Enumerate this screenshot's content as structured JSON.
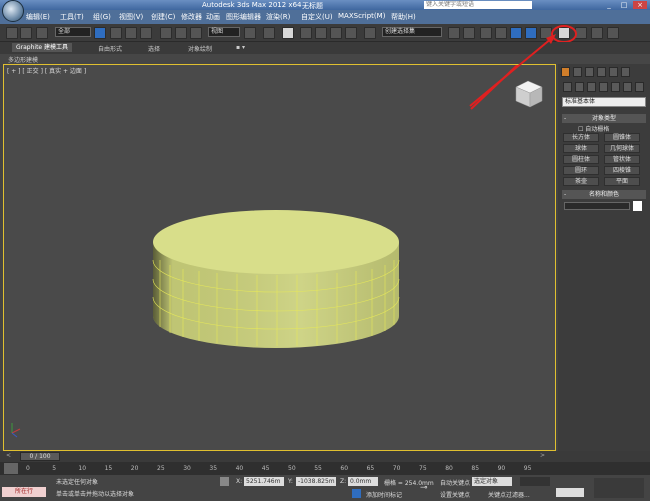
{
  "titlebar": {
    "app_title": "Autodesk 3ds Max  2012 x64",
    "doc_title": "无标题",
    "search_placeholder": "键入关键字或短语",
    "minimize": "_",
    "maximize": "□",
    "close": "×"
  },
  "menu": {
    "items": [
      "编辑(E)",
      "工具(T)",
      "组(G)",
      "视图(V)",
      "创建(C)",
      "修改器",
      "动画",
      "图形编辑器",
      "渲染(R)",
      "自定义(U)",
      "MAXScript(M)",
      "帮助(H)"
    ]
  },
  "toolbar": {
    "selection_filter": "全部",
    "ref_coord": "视图",
    "named_selection": "创建选择集"
  },
  "ribbon": {
    "tabs": [
      "Graphite 建模工具",
      "自由形式",
      "选择",
      "对象绘制"
    ],
    "sub_label": "多边形建模"
  },
  "viewport": {
    "label": "[ + ] [ 正交 ] [ 真实 + 边面 ]"
  },
  "cmdpanel": {
    "dropdown": "标准基本体",
    "object_type_header": "对象类型",
    "autogrid": "自动栅格",
    "buttons": [
      "长方体",
      "圆锥体",
      "球体",
      "几何球体",
      "圆柱体",
      "管状体",
      "圆环",
      "四棱锥",
      "茶壶",
      "平面"
    ],
    "name_color_header": "名称和颜色"
  },
  "timeline": {
    "frame_readout": "0 / 100",
    "ticks": [
      "0",
      "5",
      "10",
      "15",
      "20",
      "25",
      "30",
      "35",
      "40",
      "45",
      "50",
      "55",
      "60",
      "65",
      "70",
      "75",
      "80",
      "85",
      "90",
      "95"
    ]
  },
  "status": {
    "maxscript_label": "所在行",
    "line1": "未选定任何对象",
    "line2": "单击或单击并拖动以选择对象",
    "x_label": "X:",
    "x_value": "5251.746m",
    "y_label": "Y:",
    "y_value": "-1038.825m",
    "z_label": "Z:",
    "z_value": "0.0mm",
    "grid": "栅格 = 254.0mm",
    "add_time_tag": "添加时间标记",
    "auto_key": "自动关键点",
    "selected": "选定对象",
    "set_key": "设置关键点",
    "key_filters": "关键点过滤器..."
  }
}
